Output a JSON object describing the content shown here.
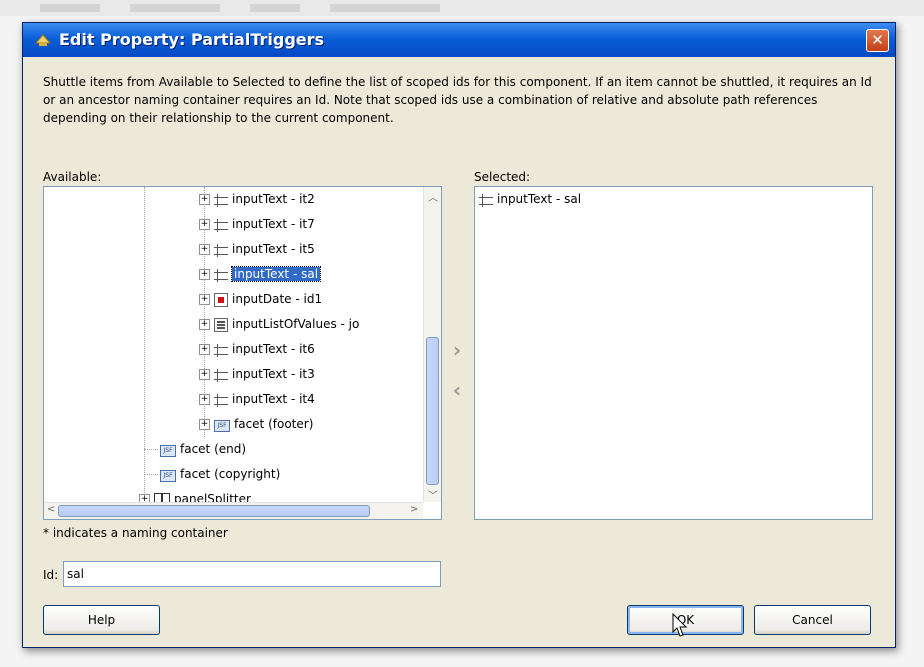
{
  "dialog": {
    "title": "Edit Property: PartialTriggers",
    "close_glyph": "✕",
    "description": "Shuttle items from Available to Selected to define the list of scoped ids for this component. If an item cannot be shuttled, it requires an Id or an ancestor naming container requires an Id. Note that scoped ids use a combination of relative and absolute path references depending on their relationship to the current component."
  },
  "available": {
    "label": "Available:",
    "items": [
      {
        "label": "inputText - it2",
        "icon": "input-text-icon"
      },
      {
        "label": "inputText - it7",
        "icon": "input-text-icon"
      },
      {
        "label": "inputText - it5",
        "icon": "input-text-icon"
      },
      {
        "label": "inputText - sal",
        "icon": "input-text-icon",
        "selected": true
      },
      {
        "label": "inputDate - id1",
        "icon": "input-date-icon"
      },
      {
        "label": "inputListOfValues - jo",
        "icon": "list-of-values-icon"
      },
      {
        "label": "inputText - it6",
        "icon": "input-text-icon"
      },
      {
        "label": "inputText - it3",
        "icon": "input-text-icon"
      },
      {
        "label": "inputText - it4",
        "icon": "input-text-icon"
      },
      {
        "label": "facet (footer)",
        "icon": "facet-icon"
      },
      {
        "label": "facet (end)",
        "icon": "facet-icon"
      },
      {
        "label": "facet (copyright)",
        "icon": "facet-icon"
      },
      {
        "label": "panelSplitter",
        "icon": "panel-splitter-icon"
      }
    ],
    "facet_icon_text": "JSF"
  },
  "selected": {
    "label": "Selected:",
    "items": [
      {
        "label": "inputText - sal",
        "icon": "input-text-icon"
      }
    ]
  },
  "shuttle": {
    "add_glyph": "›",
    "remove_glyph": "‹"
  },
  "note": "* indicates a naming container",
  "id_field": {
    "label": "Id:",
    "value": "sal"
  },
  "buttons": {
    "help": "Help",
    "ok": "OK",
    "cancel": "Cancel"
  },
  "colors": {
    "title_bar": "#0a5fd8",
    "selection": "#316ac5",
    "dialog_bg": "#ece9d8"
  }
}
